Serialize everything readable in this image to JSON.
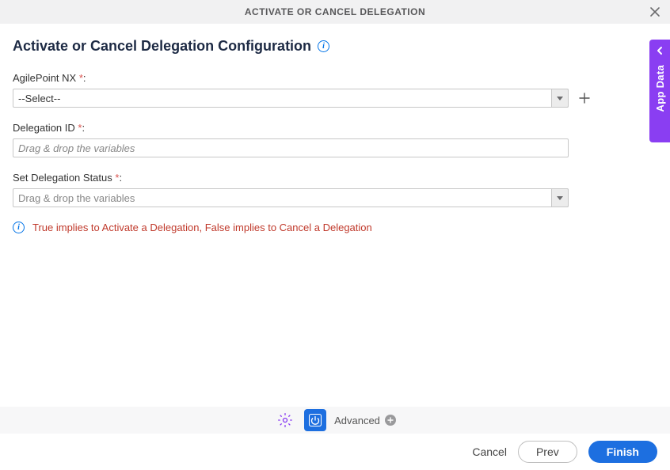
{
  "header": {
    "title": "ACTIVATE OR CANCEL DELEGATION"
  },
  "page": {
    "title": "Activate or Cancel Delegation Configuration"
  },
  "fields": {
    "agilepoint": {
      "label": "AgilePoint NX",
      "value": "--Select--"
    },
    "delegation_id": {
      "label": "Delegation ID",
      "placeholder": "Drag & drop the variables"
    },
    "status": {
      "label": "Set Delegation Status",
      "placeholder": "Drag & drop the variables"
    },
    "hint": "True implies to Activate a Delegation, False implies to Cancel a Delegation"
  },
  "side_tab": {
    "label": "App Data"
  },
  "toolbar": {
    "advanced": "Advanced"
  },
  "footer": {
    "cancel": "Cancel",
    "prev": "Prev",
    "finish": "Finish"
  }
}
